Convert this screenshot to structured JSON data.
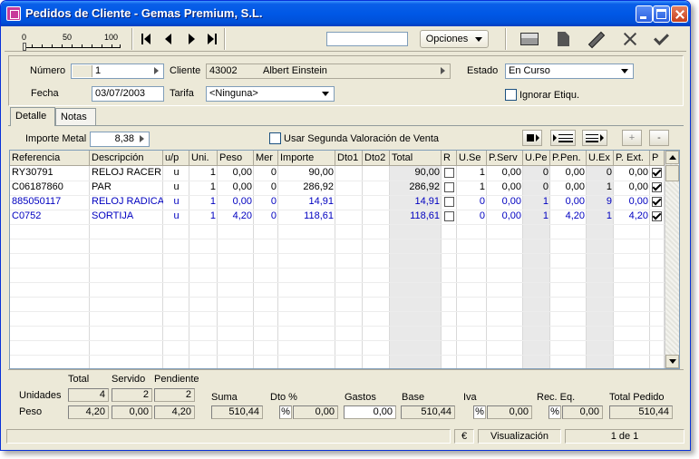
{
  "window": {
    "title": "Pedidos de Cliente - Gemas Premium, S.L."
  },
  "toolbar": {
    "zoom_ticks": [
      "0",
      "50",
      "100"
    ],
    "search_value": "",
    "options_label": "Opciones"
  },
  "header": {
    "numero_label": "Número",
    "numero_value": "1",
    "cliente_label": "Cliente",
    "cliente_code": "43002",
    "cliente_name": "Albert Einstein",
    "estado_label": "Estado",
    "estado_value": "En Curso",
    "fecha_label": "Fecha",
    "fecha_value": "03/07/2003",
    "tarifa_label": "Tarifa",
    "tarifa_value": "<Ninguna>",
    "ignorar_label": "Ignorar Etiqu."
  },
  "tabs": [
    {
      "label": "Detalle"
    },
    {
      "label": "Notas"
    }
  ],
  "detail": {
    "importe_metal_label": "Importe Metal",
    "importe_metal_value": "8,38",
    "segunda_valoracion_label": "Usar Segunda Valoración de Venta",
    "add_label": "+",
    "remove_label": "-"
  },
  "grid": {
    "headers": [
      "Referencia",
      "Descripción",
      "u/p",
      "Uni.",
      "Peso",
      "Mer",
      "Importe",
      "Dto1",
      "Dto2",
      "Total",
      "R",
      "U.Se",
      "P.Serv",
      "U.Pe",
      "P.Pen.",
      "U.Ex",
      "P. Ext.",
      "P"
    ],
    "rows": [
      {
        "ref": "RY30791",
        "desc": "RELOJ RACER",
        "up": "u",
        "uni": "1",
        "peso": "0,00",
        "mer": "0",
        "importe": "90,00",
        "dto1": "",
        "dto2": "",
        "total": "90,00",
        "r": false,
        "use": "1",
        "pserv": "0,00",
        "upe": "0",
        "ppen": "0,00",
        "uex": "0",
        "pext": "0,00",
        "p": true,
        "blue": false
      },
      {
        "ref": "C06187860",
        "desc": "PAR",
        "up": "u",
        "uni": "1",
        "peso": "0,00",
        "mer": "0",
        "importe": "286,92",
        "dto1": "",
        "dto2": "",
        "total": "286,92",
        "r": false,
        "use": "1",
        "pserv": "0,00",
        "upe": "0",
        "ppen": "0,00",
        "uex": "1",
        "pext": "0,00",
        "p": true,
        "blue": false
      },
      {
        "ref": "885050117",
        "desc": "RELOJ RADICA",
        "up": "u",
        "uni": "1",
        "peso": "0,00",
        "mer": "0",
        "importe": "14,91",
        "dto1": "",
        "dto2": "",
        "total": "14,91",
        "r": false,
        "use": "0",
        "pserv": "0,00",
        "upe": "1",
        "ppen": "0,00",
        "uex": "9",
        "pext": "0,00",
        "p": true,
        "blue": true
      },
      {
        "ref": "C0752",
        "desc": "SORTIJA",
        "up": "u",
        "uni": "1",
        "peso": "4,20",
        "mer": "0",
        "importe": "118,61",
        "dto1": "",
        "dto2": "",
        "total": "118,61",
        "r": false,
        "use": "0",
        "pserv": "0,00",
        "upe": "1",
        "ppen": "4,20",
        "uex": "1",
        "pext": "4,20",
        "p": true,
        "blue": true
      }
    ]
  },
  "totals": {
    "col_total": "Total",
    "col_servido": "Servido",
    "col_pendiente": "Pendiente",
    "unidades_label": "Unidades",
    "peso_label": "Peso",
    "unidades_total": "4",
    "unidades_servido": "2",
    "unidades_pendiente": "2",
    "peso_total": "4,20",
    "peso_servido": "0,00",
    "peso_pendiente": "4,20",
    "suma_label": "Suma",
    "suma_value": "510,44",
    "dto_label": "Dto %",
    "dto_pct_sign": "%",
    "dto_value": "0,00",
    "gastos_label": "Gastos",
    "gastos_value": "0,00",
    "base_label": "Base",
    "base_value": "510,44",
    "iva_label": "Iva",
    "iva_pct_sign": "%",
    "iva_value": "0,00",
    "receq_label": "Rec. Eq.",
    "receq_pct_sign": "%",
    "receq_value": "0,00",
    "total_pedido_label": "Total Pedido",
    "total_pedido_value": "510,44"
  },
  "status": {
    "currency": "€",
    "mode": "Visualización",
    "page": "1 de 1"
  },
  "colors": {
    "title_blue": "#0058e6",
    "row_blue": "#0000c0",
    "window_bg": "#ece9d8"
  }
}
